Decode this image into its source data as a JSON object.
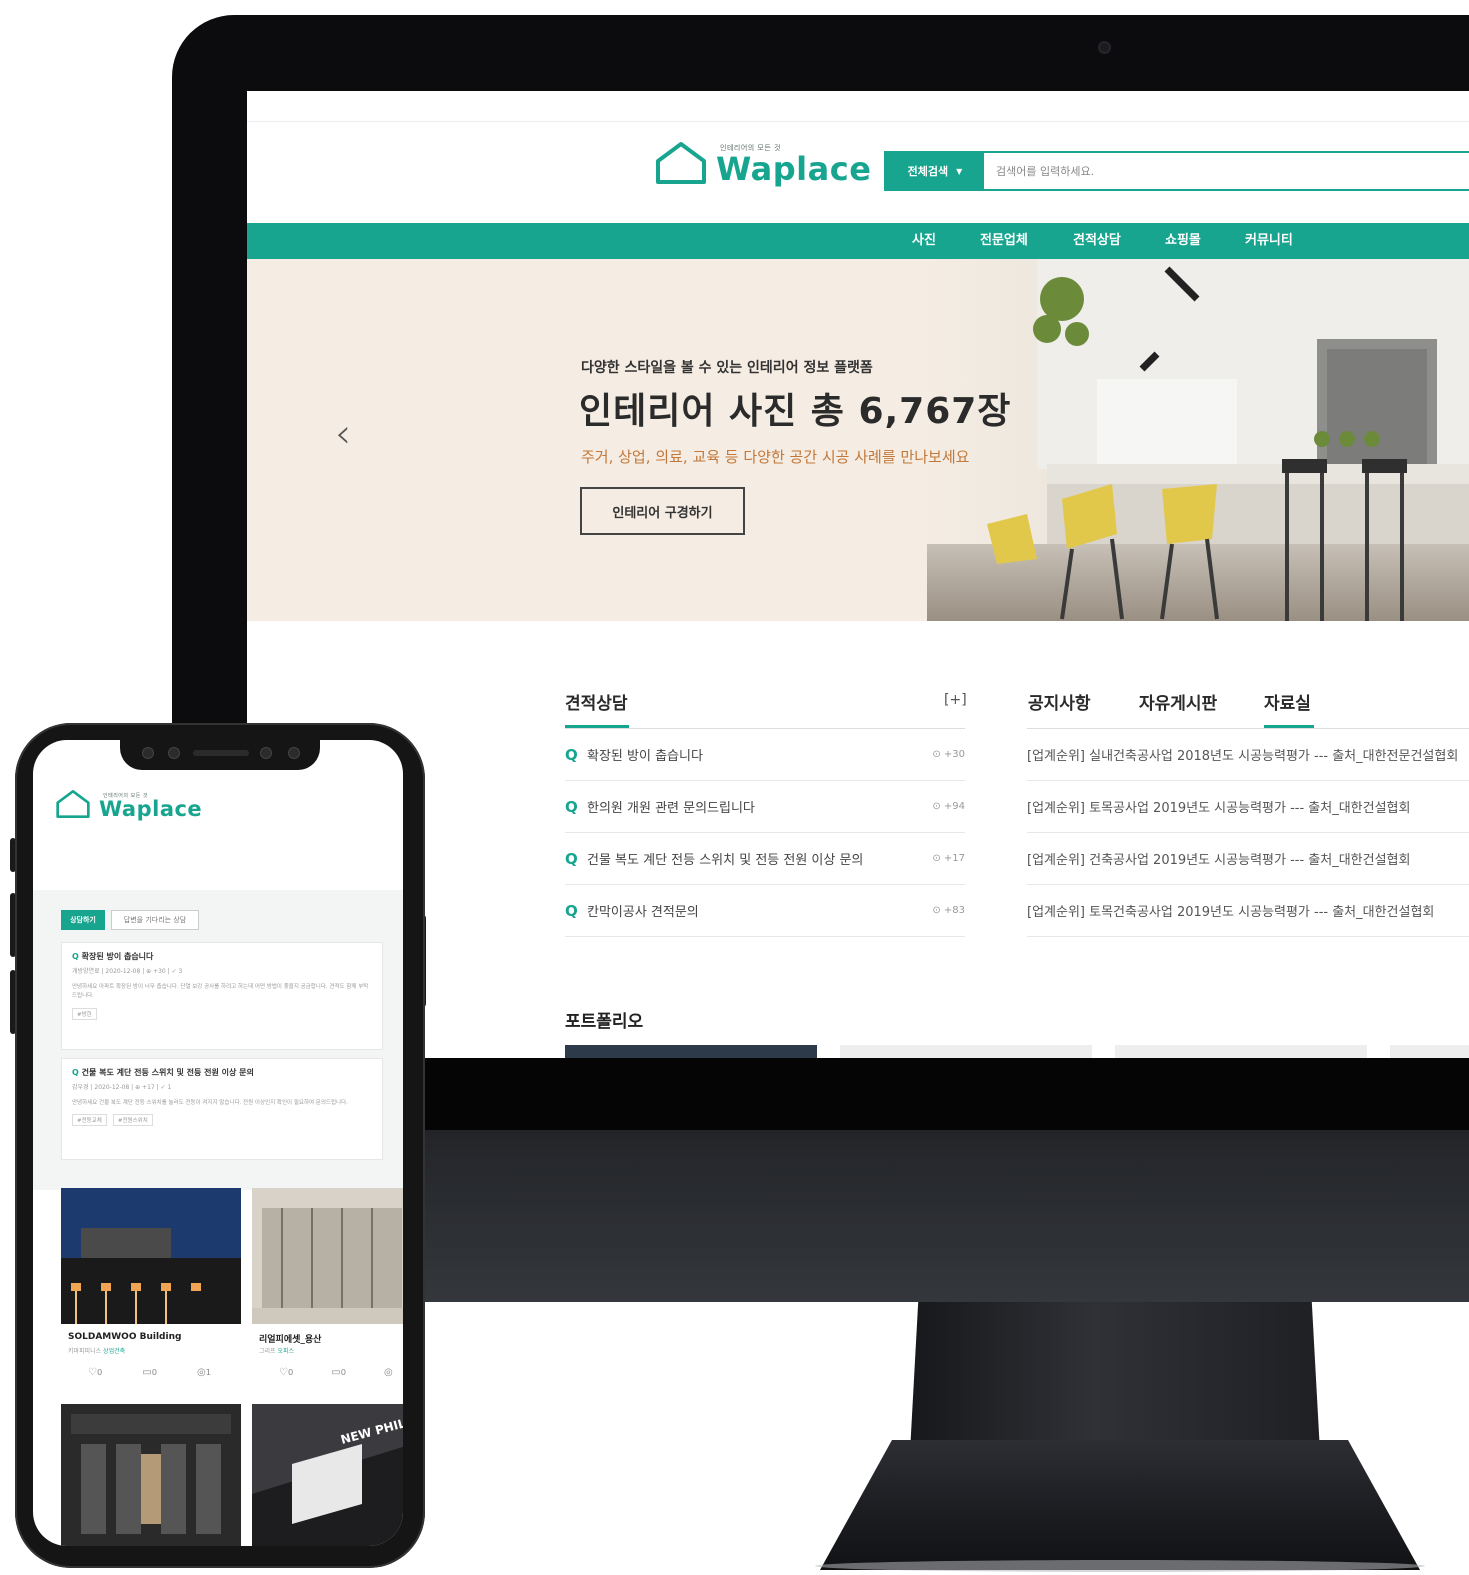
{
  "brand": {
    "name": "Waplace",
    "tagline": "인테리어의 모든 것"
  },
  "search": {
    "category": "전체검색",
    "placeholder": "검색어를 입력하세요."
  },
  "nav": [
    "사진",
    "전문업체",
    "견적상담",
    "쇼핑몰",
    "커뮤니티"
  ],
  "hero": {
    "kicker": "다양한 스타일을 볼 수 있는 인테리어 정보 플랫폼",
    "title": "인테리어 사진 총 6,767장",
    "subtitle": "주거, 상업, 의료, 교육 등 다양한 공간 시공 사례를 만나보세요",
    "button": "인테리어 구경하기"
  },
  "consult": {
    "title": "견적상담",
    "more": "[+]",
    "items": [
      {
        "title": "확장된 방이 춥습니다",
        "views": "+30"
      },
      {
        "title": "한의원 개원 관련 문의드립니다",
        "views": "+94"
      },
      {
        "title": "건물 복도 계단 전등 스위치 및 전등 전원 이상 문의",
        "views": "+17"
      },
      {
        "title": "칸막이공사 견적문의",
        "views": "+83"
      }
    ]
  },
  "board": {
    "tabs": [
      "공지사항",
      "자유게시판",
      "자료실"
    ],
    "active_tab": "자료실",
    "items": [
      "[업계순위] 실내건축공사업 2018년도 시공능력평가 --- 출처_대한전문건설협회",
      "[업계순위] 토목공사업 2019년도 시공능력평가 --- 출처_대한건설협회",
      "[업계순위] 건축공사업 2019년도 시공능력평가 --- 출처_대한건설협회",
      "[업계순위] 토목건축공사업 2019년도 시공능력평가 --- 출처_대한건설협회"
    ]
  },
  "portfolio": {
    "title": "포트폴리오"
  },
  "mobile": {
    "tabs": [
      "상담하기",
      "답변을 기다리는 상담"
    ],
    "cards": [
      {
        "title": "확장된 방이 춥습니다",
        "meta": "개방양연료 | 2020-12-08 | ⊕ +30 | ✓ 3",
        "body": "안녕하세요 아파트 확장된 방이 너무 춥습니다. 단열 보강 공사를 하려고 하는데 어떤 방법이 좋을지 궁금합니다. 견적도 함께 부탁드립니다.",
        "tags": [
          "#방한"
        ]
      },
      {
        "title": "건물 복도 계단 전등 스위치 및 전등 전원 이상 문의",
        "meta": "강우경 | 2020-12-08 | ⊕ +17 | ✓ 1",
        "body": "안녕하세요 건물 복도 계단 전등 스위치를 눌러도 전등이 켜지지 않습니다. 전원 이상인지 확인이 필요하여 문의드립니다.",
        "tags": [
          "#전등교체",
          "#전원스위치"
        ]
      }
    ],
    "tiles": [
      {
        "title": "SOLDAMWOO Building",
        "sub": "키마피피니스",
        "category": "상업건축",
        "likes": "0",
        "comments": "0",
        "views": "1"
      },
      {
        "title": "리얼피에셋_용산",
        "sub": "그리프",
        "category": "오피스",
        "likes": "0",
        "comments": "0",
        "views": ""
      }
    ]
  },
  "colors": {
    "brand": "#17a58f",
    "hero_bg": "#f5ede3",
    "accent_text": "#c2783a"
  }
}
